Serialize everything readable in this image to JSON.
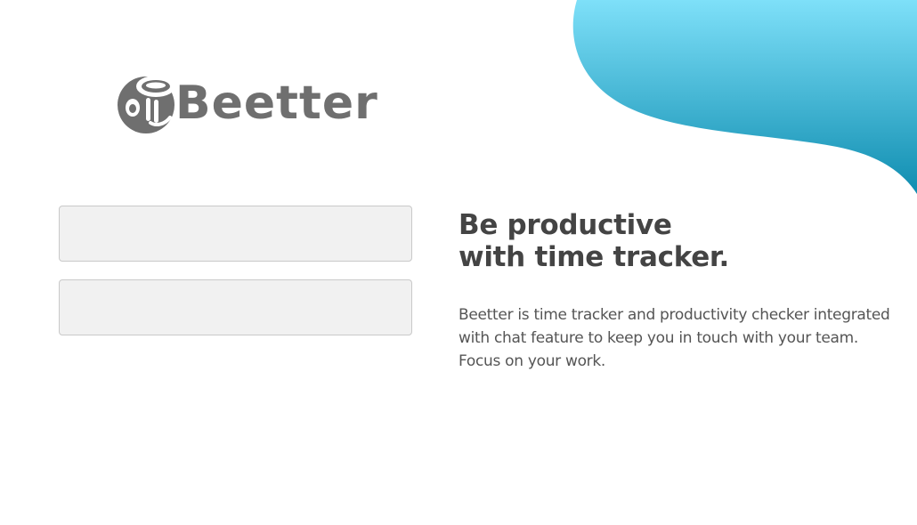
{
  "brand": {
    "name": "Beetter",
    "logo_color": "#6f6f6f",
    "accent_gradient": [
      "#7fe0f8",
      "#0f8fb0"
    ]
  },
  "login": {
    "username_value": "",
    "password_value": ""
  },
  "hero": {
    "headline_line1": "Be productive",
    "headline_line2": "with time tracker.",
    "description": "Beetter is time tracker and productivity checker integrated with chat feature to keep you in touch with your team. Focus on your work."
  }
}
